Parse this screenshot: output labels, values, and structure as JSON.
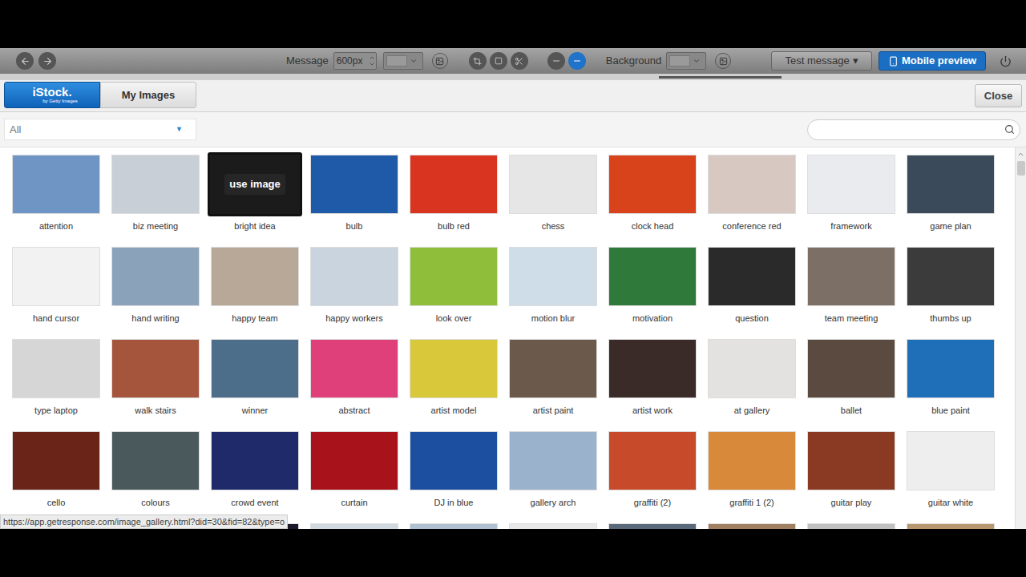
{
  "toolbar": {
    "message_label": "Message",
    "message_width": "600px",
    "background_label": "Background",
    "test_button": "Test message",
    "test_caret": "▾",
    "mobile_preview": "Mobile preview"
  },
  "tabs": [
    {
      "label": "iStock.",
      "sublabel": "by Getty Images",
      "selected": true
    },
    {
      "label": "My Images",
      "selected": false
    }
  ],
  "close_button": "Close",
  "filter": {
    "value": "All",
    "caret": "▼"
  },
  "gallery": {
    "overlay_label": "use image",
    "items": [
      {
        "label": "attention",
        "color": "#6f95c4",
        "hovered": false
      },
      {
        "label": "biz meeting",
        "color": "#c9cfd6",
        "hovered": false
      },
      {
        "label": "bright idea",
        "color": "#1b1b1b",
        "hovered": true
      },
      {
        "label": "bulb",
        "color": "#1f5aa8",
        "hovered": false
      },
      {
        "label": "bulb red",
        "color": "#d8341f",
        "hovered": false
      },
      {
        "label": "chess",
        "color": "#e6e6e6",
        "hovered": false
      },
      {
        "label": "clock head",
        "color": "#d9431c",
        "hovered": false
      },
      {
        "label": "conference red",
        "color": "#d7c8c2",
        "hovered": false
      },
      {
        "label": "framework",
        "color": "#e9ebee",
        "hovered": false
      },
      {
        "label": "game plan",
        "color": "#3a4a5a",
        "hovered": false
      },
      {
        "label": "hand cursor",
        "color": "#f2f2f2",
        "hovered": false
      },
      {
        "label": "hand writing",
        "color": "#8aa3bb",
        "hovered": false
      },
      {
        "label": "happy team",
        "color": "#b8a898",
        "hovered": false
      },
      {
        "label": "happy workers",
        "color": "#c9d4de",
        "hovered": false
      },
      {
        "label": "look over",
        "color": "#8fbf3a",
        "hovered": false
      },
      {
        "label": "motion blur",
        "color": "#cfdde8",
        "hovered": false
      },
      {
        "label": "motivation",
        "color": "#2f7a3a",
        "hovered": false
      },
      {
        "label": "question",
        "color": "#2a2a2a",
        "hovered": false
      },
      {
        "label": "team meeting",
        "color": "#7b6f66",
        "hovered": false
      },
      {
        "label": "thumbs up",
        "color": "#3b3b3b",
        "hovered": false
      },
      {
        "label": "type laptop",
        "color": "#d6d6d6",
        "hovered": false
      },
      {
        "label": "walk stairs",
        "color": "#a5553c",
        "hovered": false
      },
      {
        "label": "winner",
        "color": "#4d6e8a",
        "hovered": false
      },
      {
        "label": "abstract",
        "color": "#e0407a",
        "hovered": false
      },
      {
        "label": "artist model",
        "color": "#d8c83a",
        "hovered": false
      },
      {
        "label": "artist paint",
        "color": "#6b5a4c",
        "hovered": false
      },
      {
        "label": "artist work",
        "color": "#3a2a28",
        "hovered": false
      },
      {
        "label": "at gallery",
        "color": "#e4e2e0",
        "hovered": false
      },
      {
        "label": "ballet",
        "color": "#5a4a40",
        "hovered": false
      },
      {
        "label": "blue paint",
        "color": "#1f6fb8",
        "hovered": false
      },
      {
        "label": "cello",
        "color": "#6a2418",
        "hovered": false
      },
      {
        "label": "colours",
        "color": "#4a5a5c",
        "hovered": false
      },
      {
        "label": "crowd event",
        "color": "#1e2a6a",
        "hovered": false
      },
      {
        "label": "curtain",
        "color": "#a8121a",
        "hovered": false
      },
      {
        "label": "DJ in blue",
        "color": "#1d4fa0",
        "hovered": false
      },
      {
        "label": "gallery arch",
        "color": "#9ab2cc",
        "hovered": false
      },
      {
        "label": "graffiti (2)",
        "color": "#c74a2a",
        "hovered": false
      },
      {
        "label": "graffiti 1 (2)",
        "color": "#d88a3a",
        "hovered": false
      },
      {
        "label": "guitar play",
        "color": "#8a3a22",
        "hovered": false
      },
      {
        "label": "guitar white",
        "color": "#eeeeee",
        "hovered": false
      }
    ],
    "partial_row": [
      "#8a2a1a",
      "#c8a068",
      "#1a1a2a",
      "#d0d8e0",
      "#b0c0d0",
      "#e8e8e8",
      "#5a6a7a",
      "#a08060",
      "#c0c0c0",
      "#b89870"
    ]
  },
  "status_bar": "https://app.getresponse.com/image_gallery.html?did=30&fid=82&type=o"
}
